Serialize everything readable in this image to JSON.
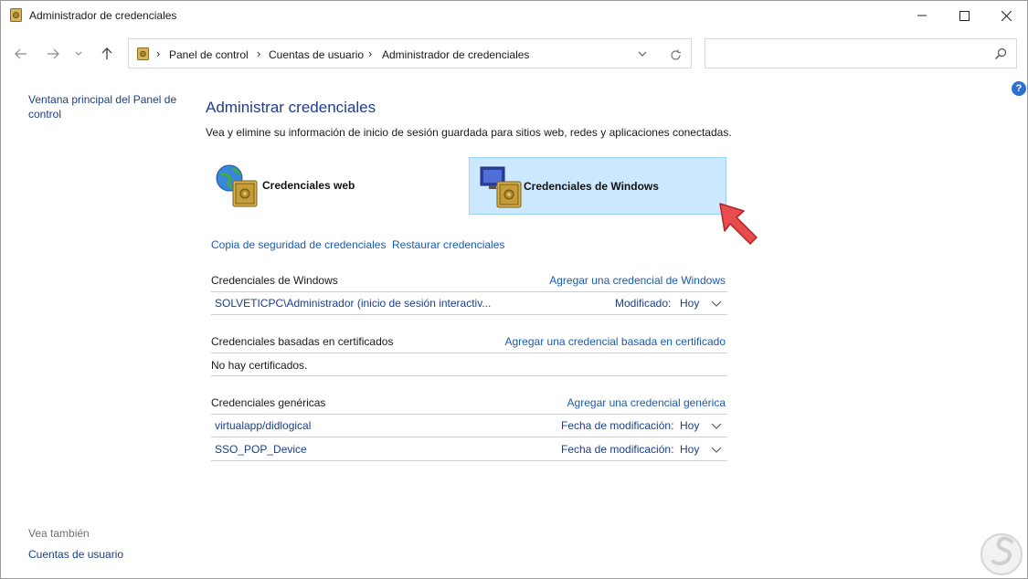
{
  "window": {
    "title": "Administrador de credenciales"
  },
  "address": {
    "crumbs": [
      "Panel de control",
      "Cuentas de usuario",
      "Administrador de credenciales"
    ]
  },
  "search": {
    "placeholder": ""
  },
  "left_pane": {
    "home_link": "Ventana principal del Panel de control",
    "see_also": "Vea también",
    "see_also_link": "Cuentas de usuario"
  },
  "main": {
    "title": "Administrar credenciales",
    "description": "Vea y elimine su información de inicio de sesión guardada para sitios web, redes y aplicaciones conectadas.",
    "tiles": {
      "web": "Credenciales web",
      "windows": "Credenciales de Windows"
    },
    "backup_link": "Copia de seguridad de credenciales",
    "restore_link": "Restaurar credenciales",
    "sections": {
      "windows": {
        "heading": "Credenciales de Windows",
        "add_link": "Agregar una credencial de Windows",
        "rows": [
          {
            "name": "SOLVETICPC\\Administrador (inicio de sesión interactiv...",
            "label": "Modificado:",
            "value": "Hoy"
          }
        ]
      },
      "certificate": {
        "heading": "Credenciales basadas en certificados",
        "add_link": "Agregar una credencial basada en certificado",
        "empty": "No hay certificados."
      },
      "generic": {
        "heading": "Credenciales genéricas",
        "add_link": "Agregar una credencial genérica",
        "rows": [
          {
            "name": "virtualapp/didlogical",
            "label": "Fecha de modificación:",
            "value": "Hoy"
          },
          {
            "name": "SSO_POP_Device",
            "label": "Fecha de modificación:",
            "value": "Hoy"
          }
        ]
      }
    }
  },
  "colors": {
    "accent": "#1a5ab0",
    "selected_tile": "#cce8ff",
    "pointer": "#e84c4c"
  }
}
